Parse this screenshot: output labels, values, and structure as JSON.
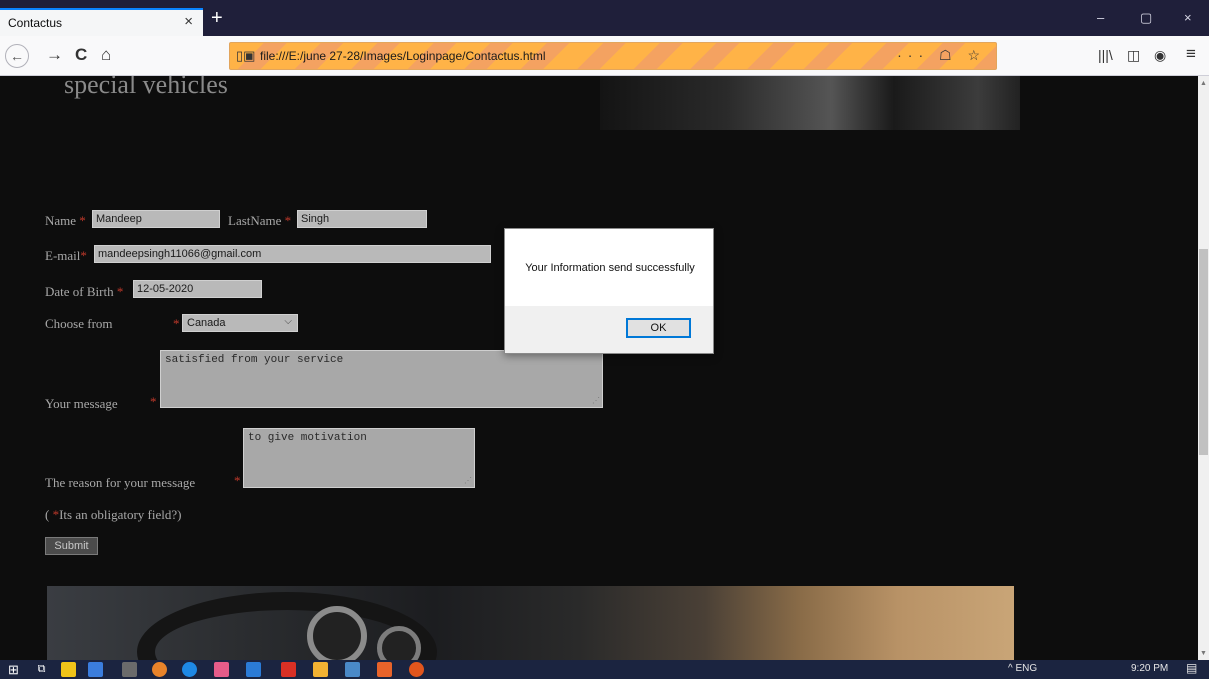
{
  "browser": {
    "tab_title": "Contactus",
    "tab_close": "×",
    "new_tab": "+",
    "url": "file:///E:/june 27-28/Images/Loginpage/Contactus.html",
    "url_actions": "··· ☖ ☆",
    "win_min": "–",
    "win_max": "▢",
    "win_close": "×",
    "nav_back": "←",
    "nav_forward": "→",
    "nav_reload": "C",
    "nav_home": "⌂",
    "tool_library": "|||\\",
    "tool_sidebar": "◫",
    "tool_account": "◉",
    "tool_menu": "≡"
  },
  "page": {
    "heading": "special vehicles",
    "form": {
      "name_label": "Name",
      "name_value": "Mandeep",
      "lastname_label": "LastName",
      "lastname_value": "Singh",
      "email_label": "E-mail",
      "email_value": "mandeepsingh11066@gmail.com",
      "dob_label": "Date of Birth",
      "dob_value": "12-05-2020",
      "choose_label": "Choose from",
      "country_value": "Canada",
      "message_label": "Your message",
      "message_value": "satisfied from your service",
      "reason_label": "The reason for your message",
      "reason_value": "to give motivation",
      "required_mark": "*",
      "note_open": "(",
      "note_text": "Its an obligatory field?)",
      "submit_label": "Submit"
    }
  },
  "dialog": {
    "message": "Your Information send  successfully",
    "ok_label": "OK"
  },
  "taskbar": {
    "start": "⊞",
    "task_view": "⧉",
    "tray_text": "^  ENG",
    "time": "9:20 PM",
    "notifications": "▤"
  },
  "colors": {
    "page_bg": "#0d0d0d",
    "required": "#c0392b",
    "url_bar": "#f4a261",
    "dialog_accent": "#0078d7"
  }
}
